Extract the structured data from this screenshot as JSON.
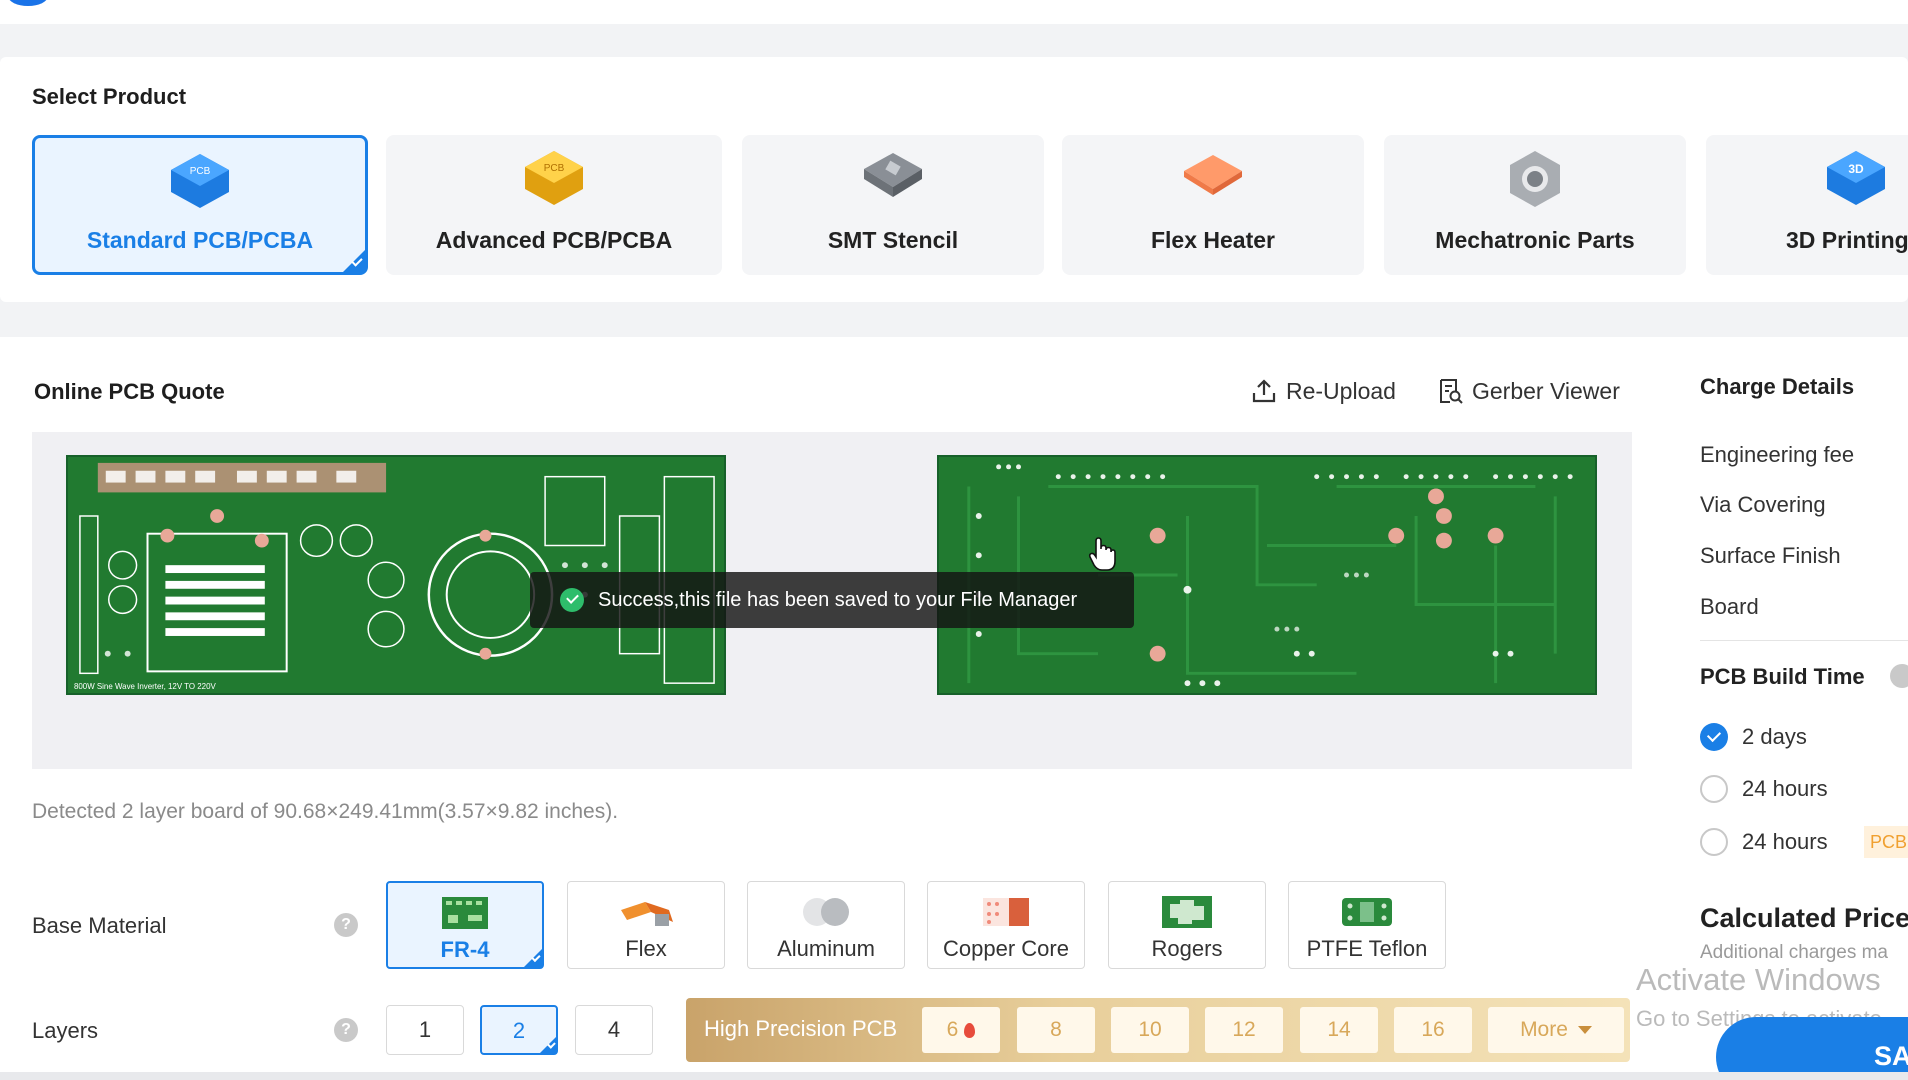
{
  "products": {
    "title": "Select Product",
    "items": [
      {
        "label": "Standard PCB/PCBA",
        "icon": "pcb-chip-blue-icon",
        "badge": "PCB"
      },
      {
        "label": "Advanced PCB/PCBA",
        "icon": "pcb-chip-gold-icon",
        "badge": "PCB"
      },
      {
        "label": "SMT Stencil",
        "icon": "stencil-icon"
      },
      {
        "label": "Flex Heater",
        "icon": "flex-heater-icon"
      },
      {
        "label": "Mechatronic Parts",
        "icon": "hex-nut-icon"
      },
      {
        "label": "3D Printing",
        "icon": "3d-printing-icon",
        "badge": "3D"
      }
    ]
  },
  "quote": {
    "title": "Online PCB Quote",
    "reupload_label": "Re-Upload",
    "gerber_label": "Gerber Viewer",
    "toast": "Success,this file has been saved to your File Manager",
    "detected": "Detected 2 layer board of 90.68×249.41mm(3.57×9.82 inches).",
    "board_silk": "800W Sine Wave Inverter, 12V TO 220V"
  },
  "base_material": {
    "label": "Base Material",
    "options": [
      "FR-4",
      "Flex",
      "Aluminum",
      "Copper Core",
      "Rogers",
      "PTFE Teflon"
    ],
    "selected": "FR-4"
  },
  "layers": {
    "label": "Layers",
    "options": [
      "1",
      "2",
      "4"
    ],
    "selected": "2",
    "high_precision_label": "High Precision PCB",
    "high_precision_options": [
      "6",
      "8",
      "10",
      "12",
      "14",
      "16"
    ],
    "more_label": "More"
  },
  "charge_details": {
    "title": "Charge Details",
    "items": [
      "Engineering fee",
      "Via Covering",
      "Surface Finish",
      "Board"
    ]
  },
  "build_time": {
    "title": "PCB Build Time",
    "options": [
      "2 days",
      "24 hours",
      "24 hours"
    ],
    "selected": "2 days",
    "tag": "PCB"
  },
  "price": {
    "title": "Calculated Price",
    "subtitle": "Additional charges ma",
    "save_button": "SA"
  },
  "watermark": {
    "line1": "Activate Windows",
    "line2": "Go to Settings to activate"
  },
  "colors": {
    "accent": "#1a7fe6",
    "board_green": "#217a30",
    "high_precision": "#c9a36a"
  }
}
